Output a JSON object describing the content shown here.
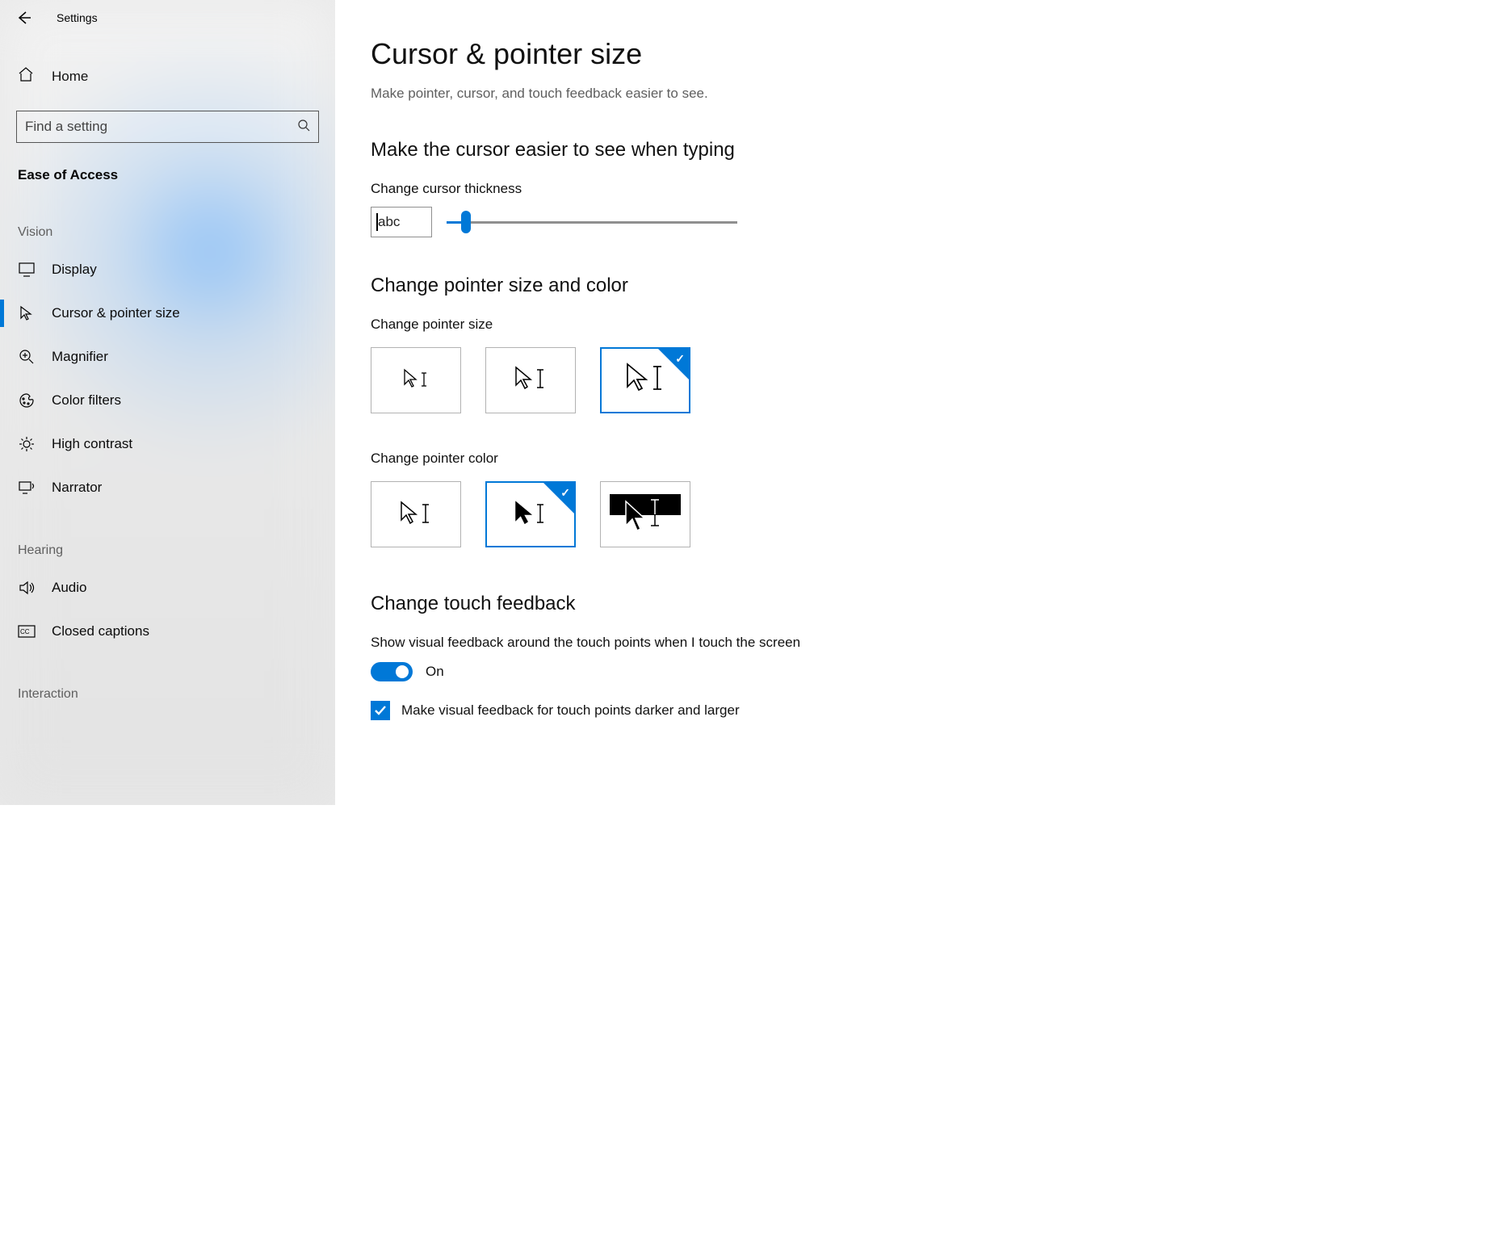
{
  "titlebar": {
    "title": "Settings"
  },
  "sidebar": {
    "home": "Home",
    "search_placeholder": "Find a setting",
    "category": "Ease of Access",
    "groups": [
      {
        "name": "Vision",
        "items": [
          {
            "key": "display",
            "label": "Display"
          },
          {
            "key": "cursor",
            "label": "Cursor & pointer size",
            "selected": true
          },
          {
            "key": "magnifier",
            "label": "Magnifier"
          },
          {
            "key": "color-filters",
            "label": "Color filters"
          },
          {
            "key": "high-contrast",
            "label": "High contrast"
          },
          {
            "key": "narrator",
            "label": "Narrator"
          }
        ]
      },
      {
        "name": "Hearing",
        "items": [
          {
            "key": "audio",
            "label": "Audio"
          },
          {
            "key": "closed-captions",
            "label": "Closed captions"
          }
        ]
      },
      {
        "name": "Interaction",
        "items": []
      }
    ]
  },
  "main": {
    "title": "Cursor & pointer size",
    "subtitle": "Make pointer, cursor, and touch feedback easier to see.",
    "section_cursor": "Make the cursor easier to see when typing",
    "thickness_label": "Change cursor thickness",
    "thickness_preview": "abc",
    "section_pointer": "Change pointer size and color",
    "size_label": "Change pointer size",
    "size_selected_index": 2,
    "color_label": "Change pointer color",
    "color_selected_index": 1,
    "section_touch": "Change touch feedback",
    "touch_label": "Show visual feedback around the touch points when I touch the screen",
    "touch_state": "On",
    "touch_on": true,
    "darker_label": "Make visual feedback for touch points darker and larger",
    "darker_checked": true
  }
}
